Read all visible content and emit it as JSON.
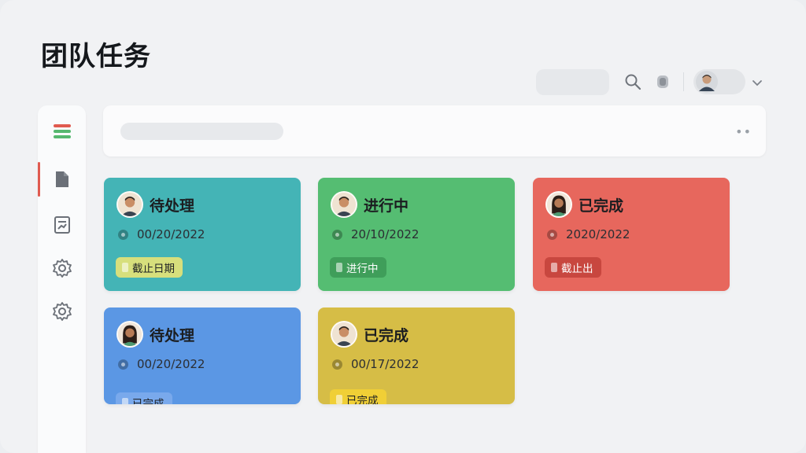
{
  "page": {
    "title": "团队任务"
  },
  "header": {
    "search_icon": "search-icon",
    "notification_icon": "bell-icon",
    "user_avatar": "user-avatar",
    "menu_icon": "chevron-down-icon"
  },
  "sidebar": {
    "items": [
      {
        "name": "menu-icon",
        "color": "#e05a4f"
      },
      {
        "name": "document-icon",
        "active": true
      },
      {
        "name": "report-icon"
      },
      {
        "name": "settings-icon"
      },
      {
        "name": "settings-icon"
      }
    ]
  },
  "cards": [
    {
      "status": "待处理",
      "date": "00/20/2022",
      "badge": "截止日期",
      "color": "#44b4b6",
      "badge_bg": "#d7df7c",
      "avatar": "man"
    },
    {
      "status": "进行中",
      "date": "20/10/2022",
      "badge": "进行中",
      "color": "#55bd72",
      "badge_bg": "#3f9e5a",
      "avatar": "man"
    },
    {
      "status": "已完成",
      "date": "2020/2022",
      "badge": "截止出",
      "color": "#e7675d",
      "badge_bg": "#c8473f",
      "avatar": "woman"
    },
    {
      "status": "待处理",
      "date": "00/20/2022",
      "badge": "已完成",
      "color": "#5b97e4",
      "badge_bg": "#79a9ec",
      "avatar": "woman"
    },
    {
      "status": "已完成",
      "date": "00/17/2022",
      "badge": "已完成",
      "color": "#d6bd46",
      "badge_bg": "#f0cf36",
      "avatar": "man"
    }
  ],
  "colors": {
    "teal": "#44b4b6",
    "green": "#55bd72",
    "red": "#e7675d",
    "blue": "#5b97e4",
    "yellow": "#d6bd46"
  }
}
